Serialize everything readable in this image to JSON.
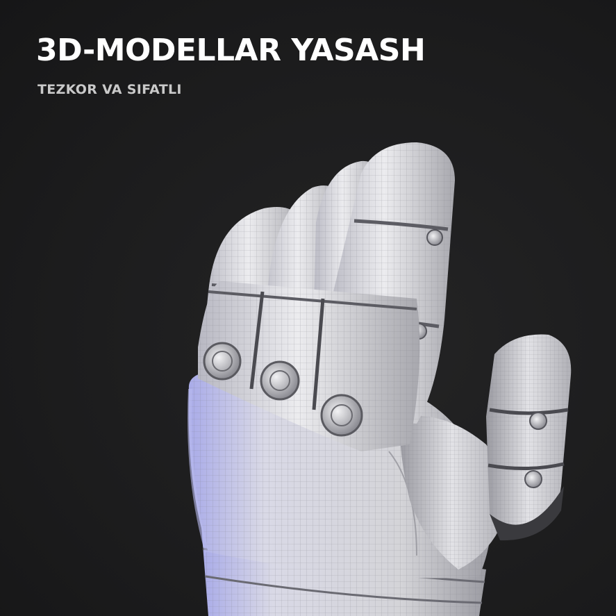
{
  "headline": "3D-MODELLAR YASASH",
  "subheadline": "TEZKOR VA SIFATLI",
  "illustration": {
    "subject": "robotic-hand-wireframe-icon",
    "colors": {
      "background": "#1d1d1e",
      "surface": "#e4e4e7",
      "surface_shadow": "#8f8f97",
      "rim_light": "#b9bbef",
      "wire": "#6d6d75"
    }
  }
}
